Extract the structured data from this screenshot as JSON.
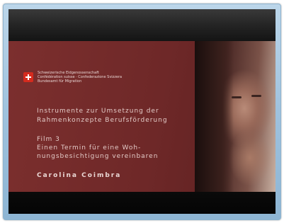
{
  "slide": {
    "logo_icon": "swiss-cross-icon",
    "department_lines": [
      "Schweizerische Eidgenossenschaft",
      "Confédération suisse · Confederazione Svizzera",
      "Bundesamt für Migration"
    ],
    "title_lines": [
      "Instrumente zur Umsetzung der",
      "Rahmenkonzepte Berufsförderung"
    ],
    "subtitle_lines": [
      "Film 3",
      "Einen Termin für eine Woh-",
      "nungsbesichtigung vereinbaren"
    ],
    "author": "Carolina Coimbra"
  },
  "colors": {
    "frame": "#9fc2de",
    "slide_background": "#7c2f2e",
    "swiss_red": "#d52b1e"
  }
}
